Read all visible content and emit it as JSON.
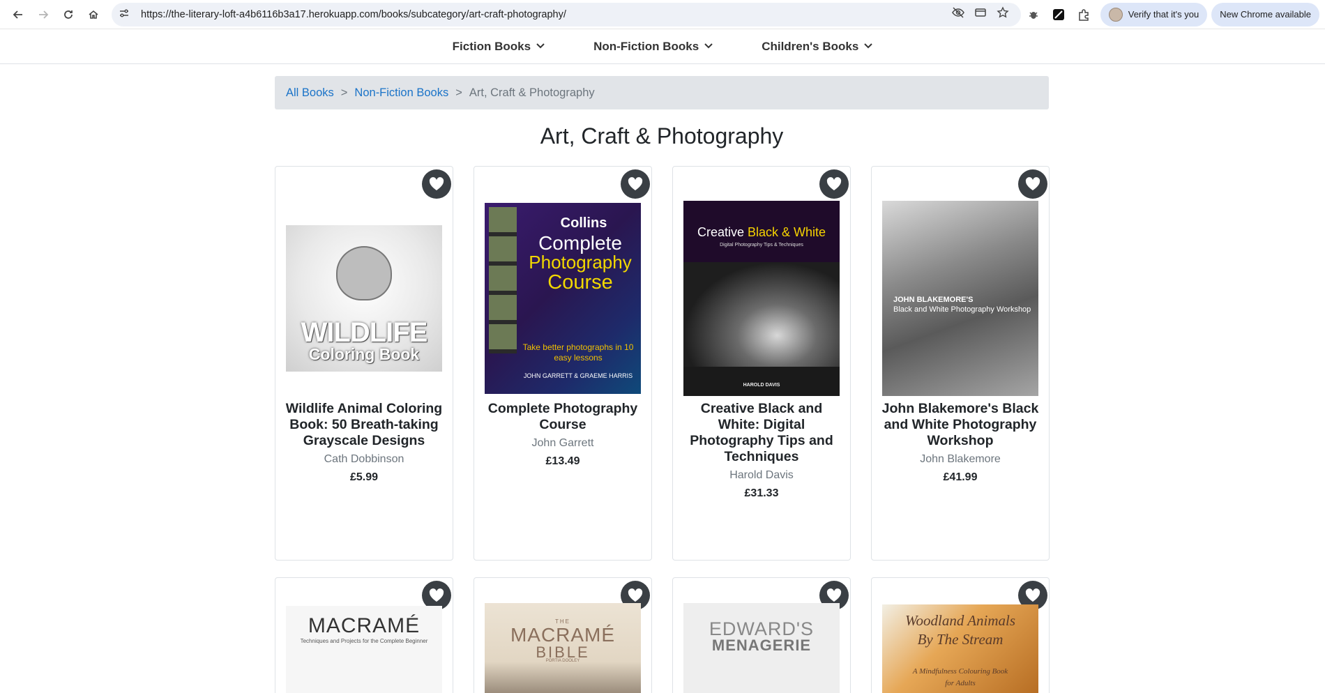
{
  "browser": {
    "url": "https://the-literary-loft-a4b6116b3a17.herokuapp.com/books/subcategory/art-craft-photography/",
    "verify_label": "Verify that it's you",
    "update_label": "New Chrome available"
  },
  "nav": {
    "menus": [
      {
        "label": "Fiction Books"
      },
      {
        "label": "Non-Fiction Books"
      },
      {
        "label": "Children's Books"
      }
    ]
  },
  "breadcrumb": {
    "all_books": "All Books",
    "separator": ">",
    "category": "Non-Fiction Books",
    "current": "Art, Craft & Photography"
  },
  "page_title": "Art, Craft & Photography",
  "books": [
    {
      "title": "Wildlife Animal Coloring Book: 50 Breath-taking Grayscale Designs",
      "author": "Cath Dobbinson",
      "price": "£5.99",
      "cover_text": [
        "WILDLIFE",
        "Coloring Book"
      ]
    },
    {
      "title": "Complete Photography Course",
      "author": "John Garrett",
      "price": "£13.49",
      "cover_text": [
        "Collins",
        "Complete",
        "Photography",
        "Course",
        "Take better photographs in 10 easy lessons",
        "JOHN GARRETT & GRAEME HARRIS"
      ]
    },
    {
      "title": "Creative Black and White: Digital Photography Tips and Techniques",
      "author": "Harold Davis",
      "price": "£31.33",
      "cover_text": [
        "Creative",
        "Black & White",
        "Digital Photography Tips & Techniques",
        "HAROLD DAVIS"
      ]
    },
    {
      "title": "John Blakemore's Black and White Photography Workshop",
      "author": "John Blakemore",
      "price": "£41.99",
      "cover_text": [
        "JOHN BLAKEMORE'S",
        "Black and White Photography Workshop"
      ]
    },
    {
      "cover_text": [
        "MACRAMÉ",
        "Techniques and Projects for the Complete Beginner"
      ]
    },
    {
      "cover_text": [
        "THE",
        "MACRAMÉ",
        "BIBLE",
        "PORTIA DOOLEY"
      ]
    },
    {
      "cover_text": [
        "EDWARD'S",
        "MENAGERIE"
      ]
    },
    {
      "cover_text": [
        "Woodland Animals",
        "By The Stream",
        "A Mindfulness Colouring Book",
        "for Adults"
      ]
    }
  ]
}
